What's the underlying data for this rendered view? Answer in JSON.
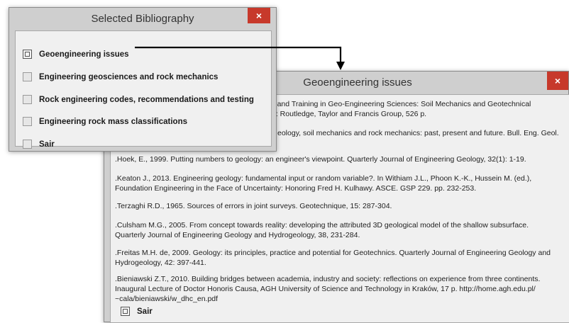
{
  "window1": {
    "title": "Selected Bibliography",
    "close_label": "×",
    "items": [
      {
        "label": "Geoengineering issues",
        "active": true
      },
      {
        "label": "Engineering geosciences and rock mechanics",
        "active": false
      },
      {
        "label": "Rock engineering codes, recommendations and testing",
        "active": false
      },
      {
        "label": "Engineering rock mass classifications",
        "active": false
      },
      {
        "label": "Sair",
        "active": false
      }
    ]
  },
  "window2": {
    "title": "Geoengineering issues",
    "close_label": "×",
    "references": [
      {
        "lines": [
          "on and Training in Geo-Engineering Sciences: Soil Mechanics and Geotechnical",
          "ics: Routledge, Taylor and Francis Group, 526 p."
        ]
      },
      {
        "lines": [
          "eology, soil mechanics and rock mechanics: past, present and future. Bull. Eng. Geol."
        ]
      },
      {
        "lines": [
          ".Hoek, E., 1999. Putting numbers to geology: an engineer's viewpoint. Quarterly Journal of Engineering Geology, 32(1): 1-19."
        ]
      },
      {
        "lines": [
          ".Keaton J., 2013. Engineering geology: fundamental input or random variable?. In Withiam J.L., Phoon K.-K., Hussein M. (ed.),",
          "Foundation Engineering in the Face of Uncertainty: Honoring Fred H. Kulhawy. ASCE. GSP 229. pp. 232-253."
        ]
      },
      {
        "lines": [
          ".Terzaghi R.D., 1965. Sources of errors in joint surveys. Geotechnique, 15: 287-304."
        ]
      },
      {
        "lines": [
          ".Culsham M.G., 2005. From concept towards reality: developing the attributed 3D geological model of the shallow subsurface.",
          "Quarterly Journal of Engineering Geology and Hydrogeology, 38, 231-284."
        ]
      },
      {
        "lines": [
          ".Freitas M.H. de, 2009. Geology: its principles, practice and potential for Geotechnics. Quarterly Journal of Engineering Geology and",
          "Hydrogeology, 42: 397-441."
        ]
      },
      {
        "lines": [
          ".Bieniawski Z.T., 2010. Building bridges between academia, industry and society: reflections on experience from three continents.",
          "Inaugural Lecture of Doctor Honoris Causa, AGH University of Science and Technology in Kraków, 17 p. http://home.agh.edu.pl/",
          "~cala/bieniawski/w_dhc_en.pdf"
        ]
      }
    ],
    "sair_label": "Sair"
  },
  "colors": {
    "close_button": "#c7392b",
    "window_frame": "#cfcfcf",
    "client_bg": "#f0f0f0",
    "arrow": "#000000"
  }
}
